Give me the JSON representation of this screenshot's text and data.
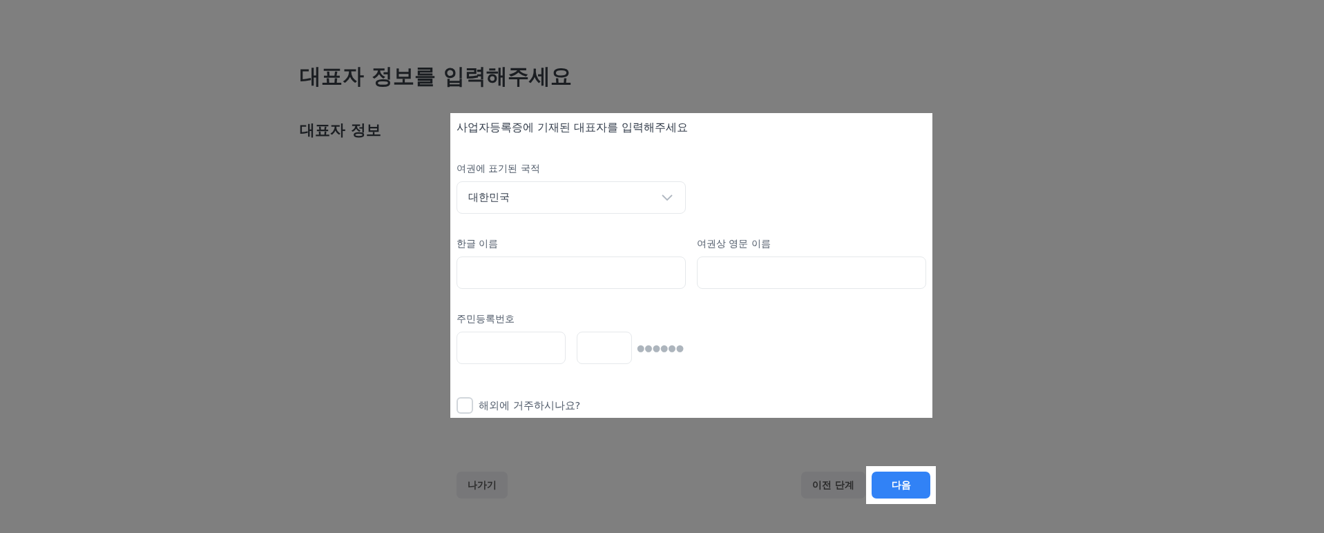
{
  "title": "대표자 정보를 입력해주세요",
  "section_label": "대표자 정보",
  "panel": {
    "subtitle": "사업자등록증에 기재된 대표자를 입력해주세요",
    "nationality": {
      "label": "여권에 표기된 국적",
      "value": "대한민국"
    },
    "korean_name": {
      "label": "한글 이름"
    },
    "english_name": {
      "label": "여권상 영문 이름"
    },
    "rrn": {
      "label": "주민등록번호",
      "mask": "●●●●●●"
    },
    "overseas": {
      "label": "해외에 거주하시나요?",
      "checked": false
    }
  },
  "buttons": [
    {
      "label": "나가기",
      "kind": "secondary",
      "highlighted": false
    },
    {
      "label": "이전 단계",
      "kind": "secondary",
      "highlighted": false
    },
    {
      "label": "다음",
      "kind": "primary",
      "highlighted": true
    }
  ]
}
